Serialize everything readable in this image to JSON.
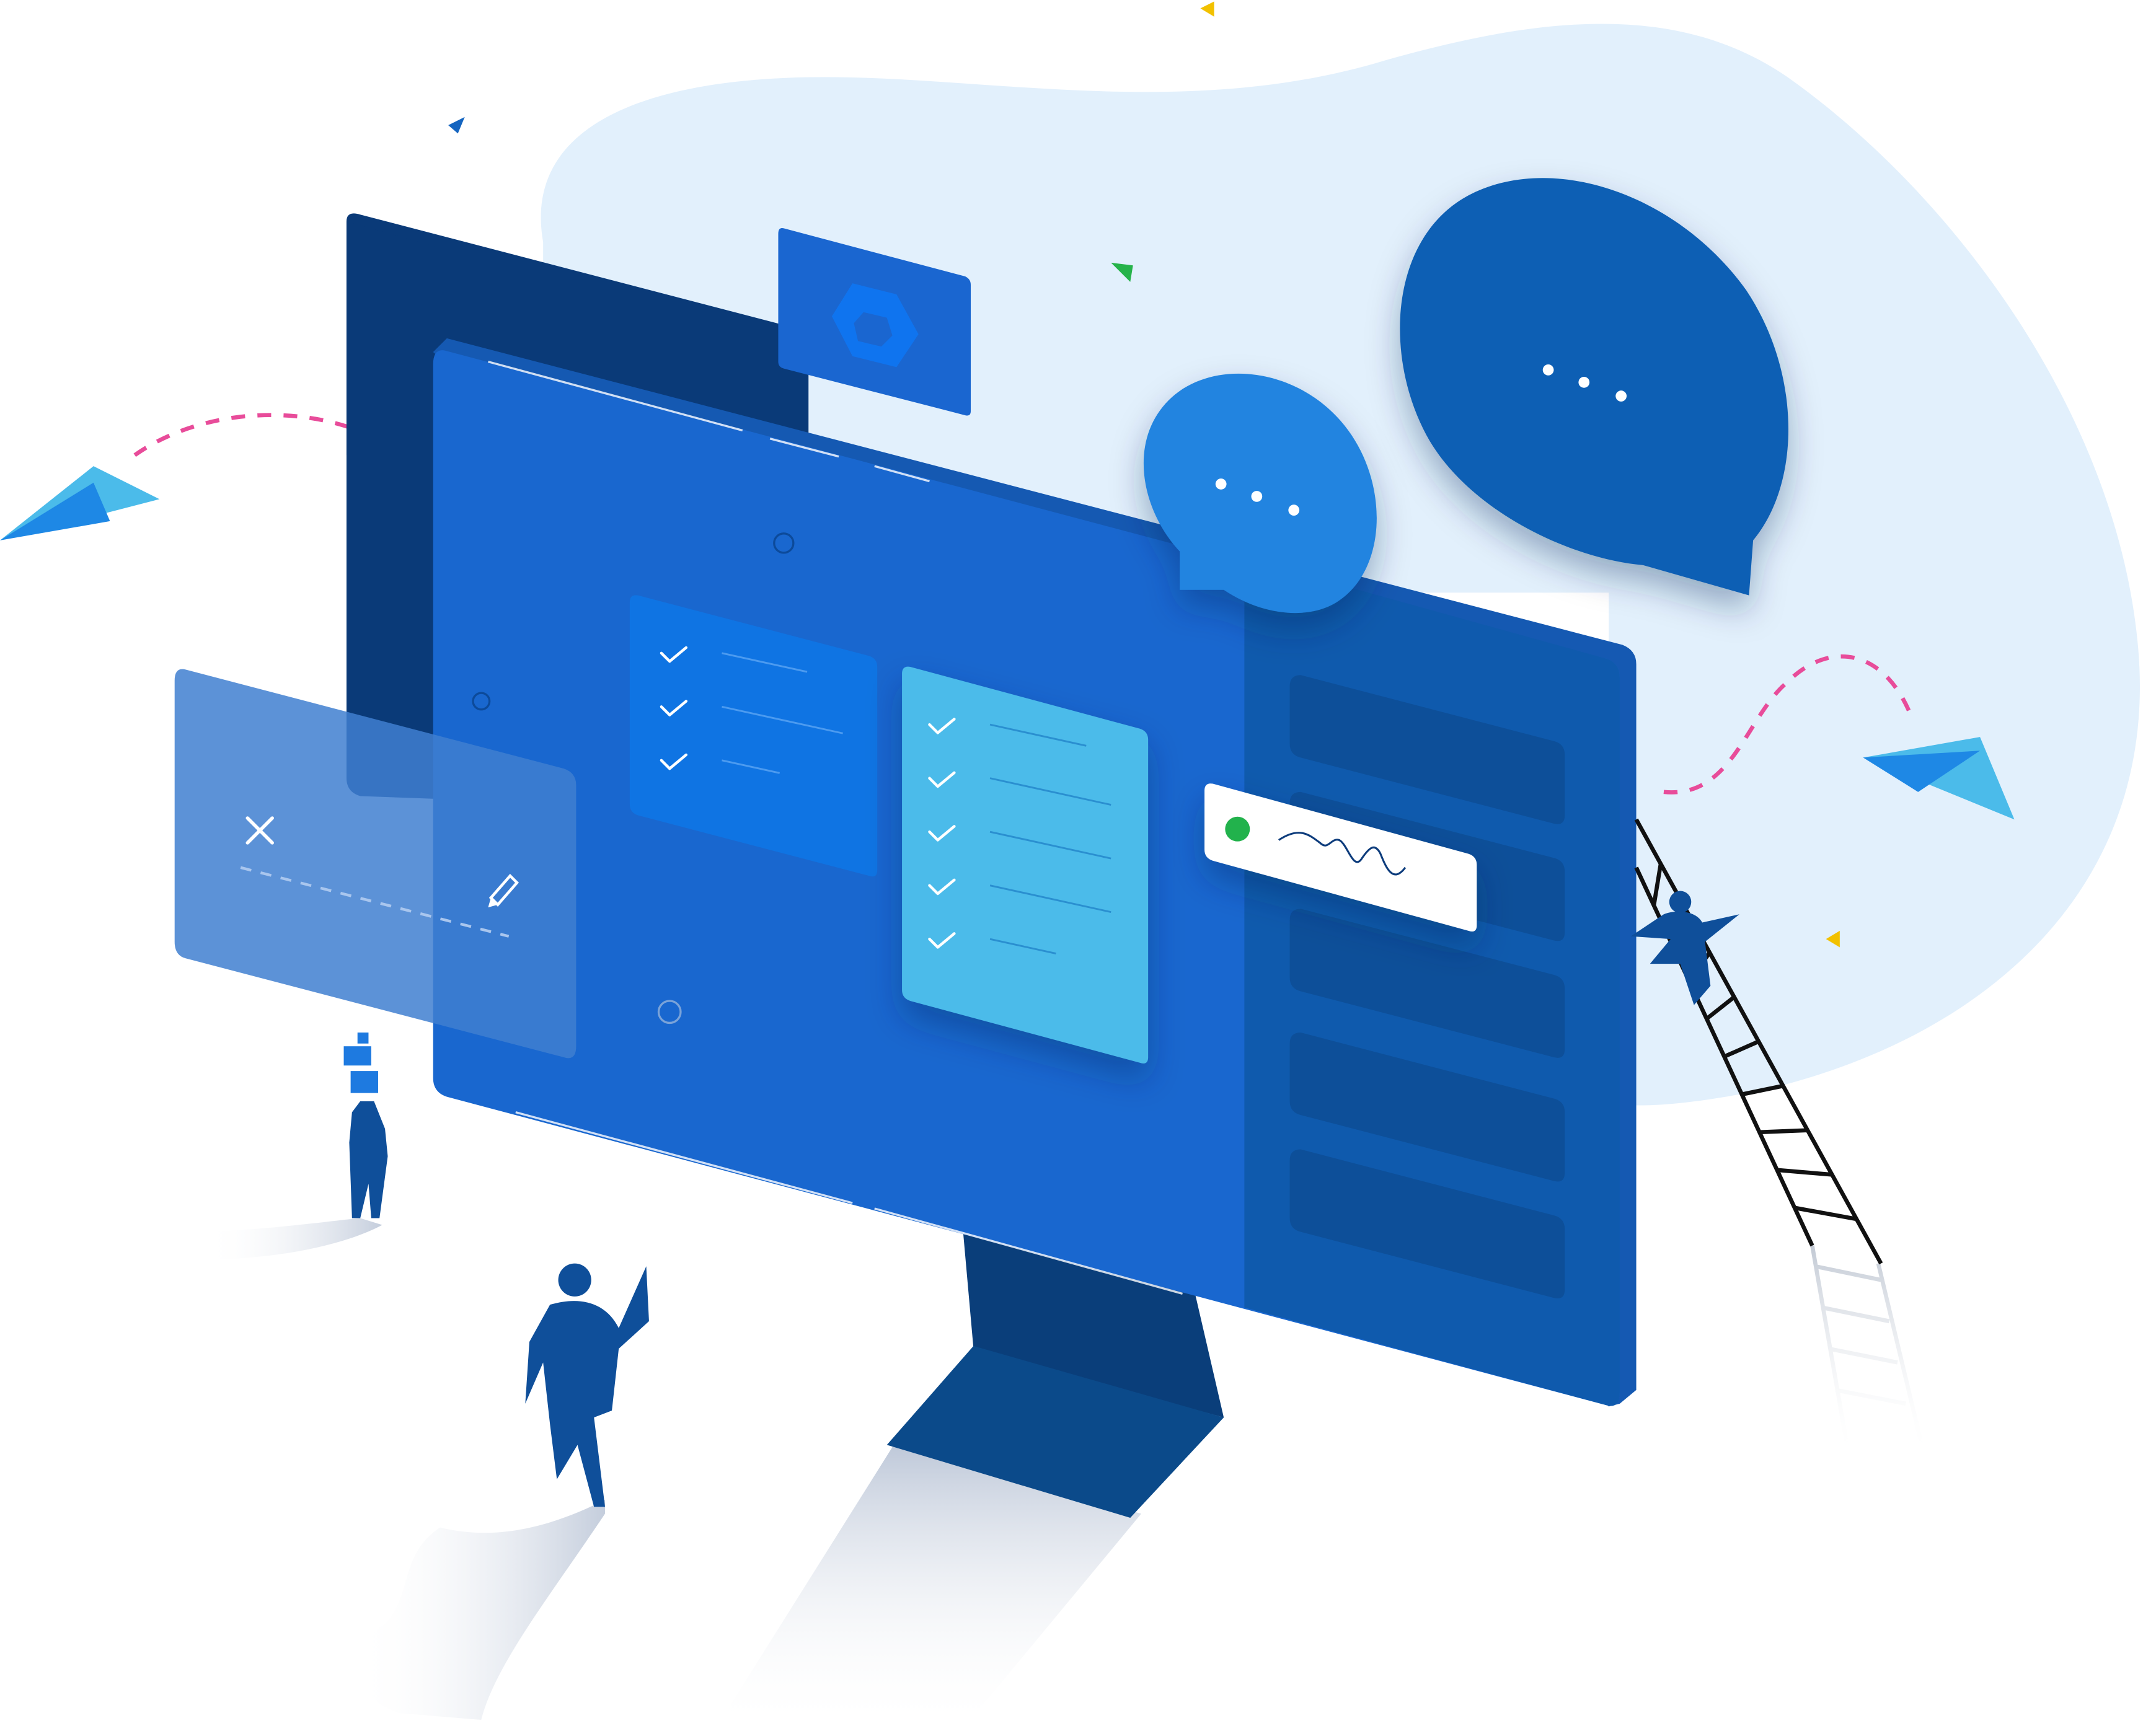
{
  "colors": {
    "background": "#ffffff",
    "blob": "#e2f0fc",
    "screen_frame": "#0a3a78",
    "screen": "#1967cf",
    "screen_side": "#1559b2",
    "sidebar": "#0f5aad",
    "sidebar_card": "#0d4f99",
    "stand": "#0b4a8a",
    "stand_neck": "#0a3e7a",
    "panel_overlay": "#3f7fd0",
    "checklist_dark": "#0f74e3",
    "checklist_light": "#4bbbea",
    "bubble_small": "#2484e0",
    "bubble_large": "#0f5eb4",
    "hexagon_card": "#1a66d0",
    "hexagon": "#0f74ef",
    "paper_plane": "#4bbbea",
    "paper_plane_dark": "#1e88e5",
    "dashed_path": "#e84c9a",
    "confetti_yellow": "#f2c100",
    "confetti_green": "#26b34a",
    "confetti_blue": "#1565c0",
    "status_dot": "#22b24c",
    "people": "#0f4f9a",
    "people_light": "#1e7ae0",
    "ladder": "#111111"
  },
  "icons": {
    "checkmark": "check-icon",
    "close": "close-icon",
    "pencil": "pencil-icon",
    "hexagon": "hexagon-icon",
    "chat": "chat-bubble-icon",
    "paper_plane": "paper-plane-icon",
    "signature": "signature-icon",
    "status": "status-dot-icon"
  },
  "checklist_left": {
    "items": 3,
    "checked": 3
  },
  "checklist_right": {
    "items": 5,
    "checked": 5
  },
  "chat_bubbles": [
    {
      "name": "small",
      "dots": 3
    },
    {
      "name": "large",
      "dots": 3
    }
  ],
  "sidebar_cards": 5,
  "people": 3
}
